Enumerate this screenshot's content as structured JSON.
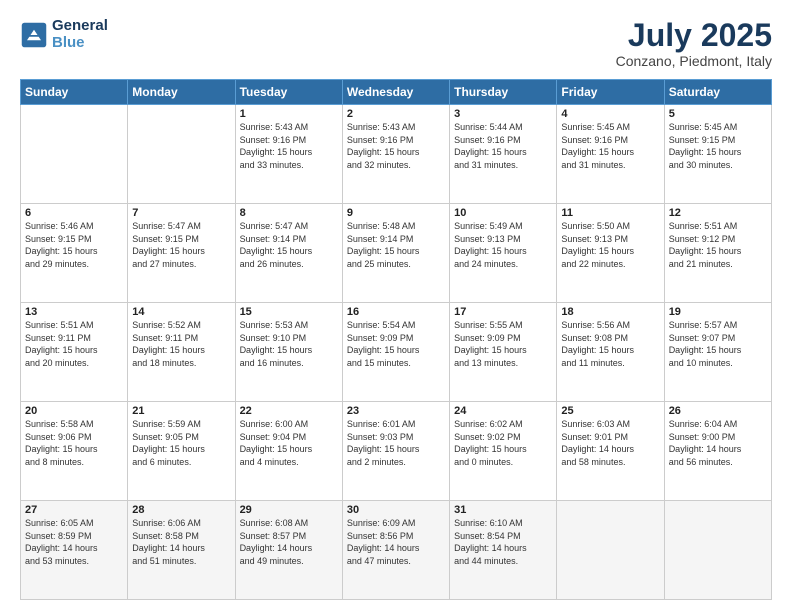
{
  "header": {
    "logo_line1": "General",
    "logo_line2": "Blue",
    "title": "July 2025",
    "subtitle": "Conzano, Piedmont, Italy"
  },
  "days_of_week": [
    "Sunday",
    "Monday",
    "Tuesday",
    "Wednesday",
    "Thursday",
    "Friday",
    "Saturday"
  ],
  "weeks": [
    [
      {
        "num": "",
        "info": ""
      },
      {
        "num": "",
        "info": ""
      },
      {
        "num": "1",
        "info": "Sunrise: 5:43 AM\nSunset: 9:16 PM\nDaylight: 15 hours\nand 33 minutes."
      },
      {
        "num": "2",
        "info": "Sunrise: 5:43 AM\nSunset: 9:16 PM\nDaylight: 15 hours\nand 32 minutes."
      },
      {
        "num": "3",
        "info": "Sunrise: 5:44 AM\nSunset: 9:16 PM\nDaylight: 15 hours\nand 31 minutes."
      },
      {
        "num": "4",
        "info": "Sunrise: 5:45 AM\nSunset: 9:16 PM\nDaylight: 15 hours\nand 31 minutes."
      },
      {
        "num": "5",
        "info": "Sunrise: 5:45 AM\nSunset: 9:15 PM\nDaylight: 15 hours\nand 30 minutes."
      }
    ],
    [
      {
        "num": "6",
        "info": "Sunrise: 5:46 AM\nSunset: 9:15 PM\nDaylight: 15 hours\nand 29 minutes."
      },
      {
        "num": "7",
        "info": "Sunrise: 5:47 AM\nSunset: 9:15 PM\nDaylight: 15 hours\nand 27 minutes."
      },
      {
        "num": "8",
        "info": "Sunrise: 5:47 AM\nSunset: 9:14 PM\nDaylight: 15 hours\nand 26 minutes."
      },
      {
        "num": "9",
        "info": "Sunrise: 5:48 AM\nSunset: 9:14 PM\nDaylight: 15 hours\nand 25 minutes."
      },
      {
        "num": "10",
        "info": "Sunrise: 5:49 AM\nSunset: 9:13 PM\nDaylight: 15 hours\nand 24 minutes."
      },
      {
        "num": "11",
        "info": "Sunrise: 5:50 AM\nSunset: 9:13 PM\nDaylight: 15 hours\nand 22 minutes."
      },
      {
        "num": "12",
        "info": "Sunrise: 5:51 AM\nSunset: 9:12 PM\nDaylight: 15 hours\nand 21 minutes."
      }
    ],
    [
      {
        "num": "13",
        "info": "Sunrise: 5:51 AM\nSunset: 9:11 PM\nDaylight: 15 hours\nand 20 minutes."
      },
      {
        "num": "14",
        "info": "Sunrise: 5:52 AM\nSunset: 9:11 PM\nDaylight: 15 hours\nand 18 minutes."
      },
      {
        "num": "15",
        "info": "Sunrise: 5:53 AM\nSunset: 9:10 PM\nDaylight: 15 hours\nand 16 minutes."
      },
      {
        "num": "16",
        "info": "Sunrise: 5:54 AM\nSunset: 9:09 PM\nDaylight: 15 hours\nand 15 minutes."
      },
      {
        "num": "17",
        "info": "Sunrise: 5:55 AM\nSunset: 9:09 PM\nDaylight: 15 hours\nand 13 minutes."
      },
      {
        "num": "18",
        "info": "Sunrise: 5:56 AM\nSunset: 9:08 PM\nDaylight: 15 hours\nand 11 minutes."
      },
      {
        "num": "19",
        "info": "Sunrise: 5:57 AM\nSunset: 9:07 PM\nDaylight: 15 hours\nand 10 minutes."
      }
    ],
    [
      {
        "num": "20",
        "info": "Sunrise: 5:58 AM\nSunset: 9:06 PM\nDaylight: 15 hours\nand 8 minutes."
      },
      {
        "num": "21",
        "info": "Sunrise: 5:59 AM\nSunset: 9:05 PM\nDaylight: 15 hours\nand 6 minutes."
      },
      {
        "num": "22",
        "info": "Sunrise: 6:00 AM\nSunset: 9:04 PM\nDaylight: 15 hours\nand 4 minutes."
      },
      {
        "num": "23",
        "info": "Sunrise: 6:01 AM\nSunset: 9:03 PM\nDaylight: 15 hours\nand 2 minutes."
      },
      {
        "num": "24",
        "info": "Sunrise: 6:02 AM\nSunset: 9:02 PM\nDaylight: 15 hours\nand 0 minutes."
      },
      {
        "num": "25",
        "info": "Sunrise: 6:03 AM\nSunset: 9:01 PM\nDaylight: 14 hours\nand 58 minutes."
      },
      {
        "num": "26",
        "info": "Sunrise: 6:04 AM\nSunset: 9:00 PM\nDaylight: 14 hours\nand 56 minutes."
      }
    ],
    [
      {
        "num": "27",
        "info": "Sunrise: 6:05 AM\nSunset: 8:59 PM\nDaylight: 14 hours\nand 53 minutes."
      },
      {
        "num": "28",
        "info": "Sunrise: 6:06 AM\nSunset: 8:58 PM\nDaylight: 14 hours\nand 51 minutes."
      },
      {
        "num": "29",
        "info": "Sunrise: 6:08 AM\nSunset: 8:57 PM\nDaylight: 14 hours\nand 49 minutes."
      },
      {
        "num": "30",
        "info": "Sunrise: 6:09 AM\nSunset: 8:56 PM\nDaylight: 14 hours\nand 47 minutes."
      },
      {
        "num": "31",
        "info": "Sunrise: 6:10 AM\nSunset: 8:54 PM\nDaylight: 14 hours\nand 44 minutes."
      },
      {
        "num": "",
        "info": ""
      },
      {
        "num": "",
        "info": ""
      }
    ]
  ]
}
